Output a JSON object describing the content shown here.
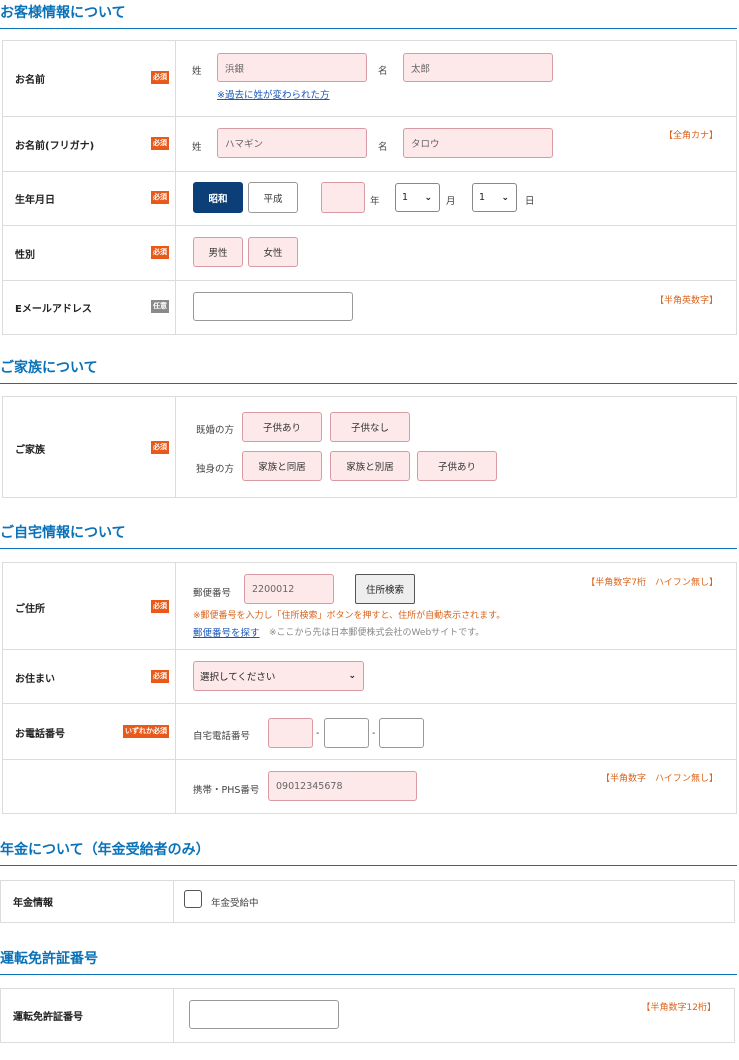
{
  "customer": {
    "title": "お客様情報について",
    "name": {
      "label": "お名前",
      "badge": "必須",
      "sei_label": "姓",
      "sei_value": "浜銀",
      "mei_label": "名",
      "mei_value": "太郎",
      "link": "※過去に姓が変わられた方"
    },
    "kana": {
      "label": "お名前(フリガナ)",
      "badge": "必須",
      "sei_label": "姓",
      "sei_value": "ハマギン",
      "mei_label": "名",
      "mei_value": "タロウ",
      "note": "【全角カナ】"
    },
    "birth": {
      "label": "生年月日",
      "badge": "必須",
      "era1": "昭和",
      "era2": "平成",
      "year_value": "",
      "year_unit": "年",
      "month_value": "1",
      "month_unit": "月",
      "day_value": "1",
      "day_unit": "日"
    },
    "gender": {
      "label": "性別",
      "badge": "必須",
      "male": "男性",
      "female": "女性"
    },
    "email": {
      "label": "Eメールアドレス",
      "badge": "任意",
      "value": "",
      "note": "【半角英数字】"
    }
  },
  "family": {
    "title": "ご家族について",
    "label": "ご家族",
    "badge": "必須",
    "married_label": "既婚の方",
    "married_opt1": "子供あり",
    "married_opt2": "子供なし",
    "single_label": "独身の方",
    "single_opt1": "家族と同居",
    "single_opt2": "家族と別居",
    "single_opt3": "子供あり"
  },
  "home": {
    "title": "ご自宅情報について",
    "address": {
      "label": "ご住所",
      "badge": "必須",
      "postal_label": "郵便番号",
      "postal_value": "2200012",
      "search_button": "住所検索",
      "note": "【半角数字7桁　ハイフン無し】",
      "warning": "※郵便番号を入力し「住所検索」ボタンを押すと、住所が自動表示されます。",
      "find_link": "郵便番号を探す",
      "find_note": "※ここから先は日本郵便株式会社のWebサイトです。"
    },
    "residence": {
      "label": "お住まい",
      "badge": "必須",
      "select_value": "選択してください"
    },
    "phone": {
      "label": "お電話番号",
      "badge": "いずれか必須",
      "home_label": "自宅電話番号",
      "dash": "-",
      "mobile_label": "携帯・PHS番号",
      "mobile_value": "09012345678",
      "note": "【半角数字　ハイフン無し】"
    }
  },
  "pension": {
    "title": "年金について（年金受給者のみ）",
    "label": "年金情報",
    "checkbox_label": "年金受給中"
  },
  "license": {
    "title": "運転免許証番号",
    "label": "運転免許証番号",
    "value": "",
    "note": "【半角数字12桁】"
  }
}
